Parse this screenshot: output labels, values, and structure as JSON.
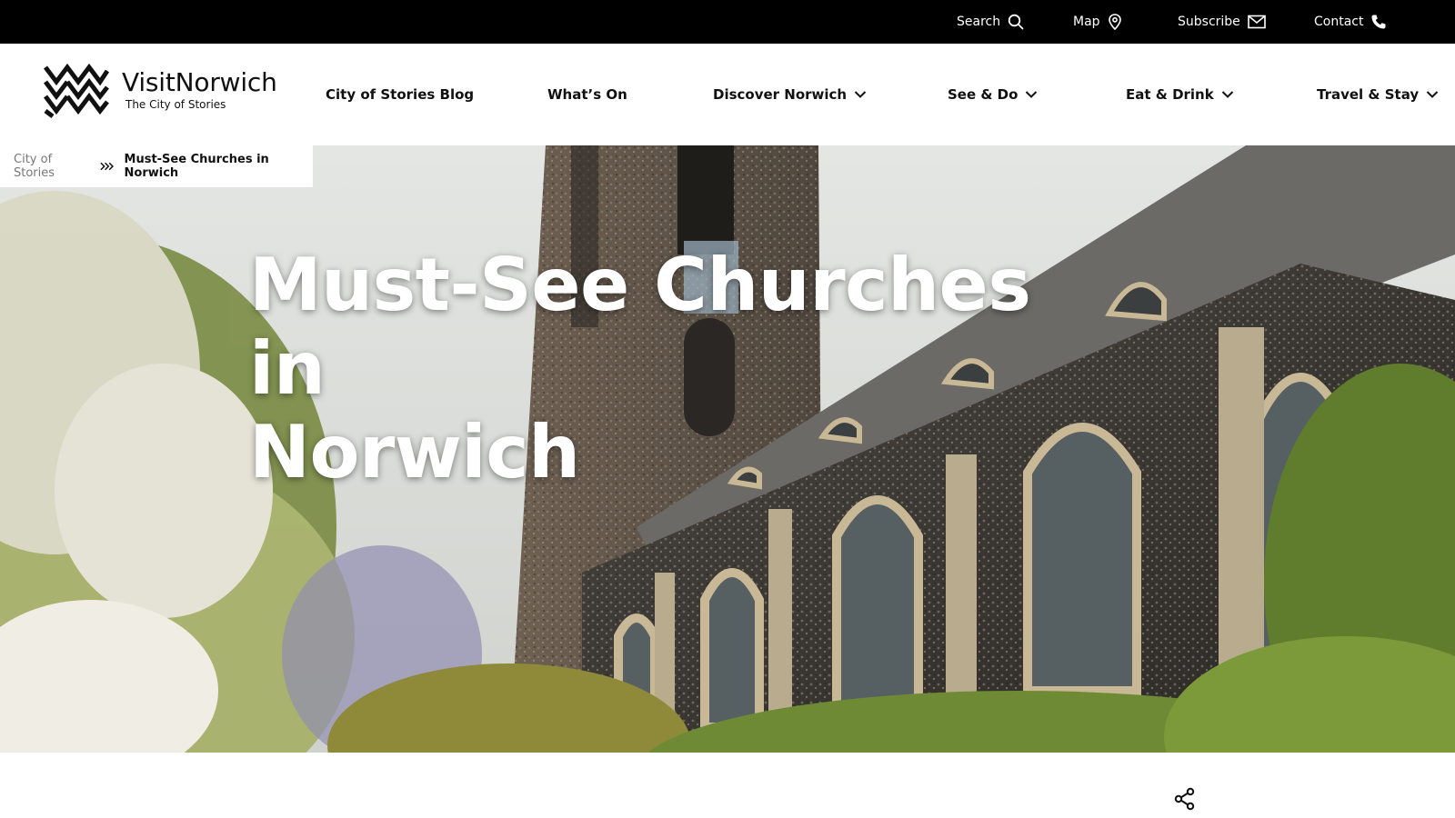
{
  "topbar": {
    "search_label": "Search",
    "map_label": "Map",
    "subscribe_label": "Subscribe",
    "contact_label": "Contact"
  },
  "logo": {
    "title": "VisitNorwich",
    "tagline": "The City of Stories"
  },
  "nav": {
    "items": [
      {
        "label": "City of Stories Blog",
        "has_dropdown": false
      },
      {
        "label": "What’s On",
        "has_dropdown": false
      },
      {
        "label": "Discover Norwich",
        "has_dropdown": true
      },
      {
        "label": "See & Do",
        "has_dropdown": true
      },
      {
        "label": "Eat & Drink",
        "has_dropdown": true
      },
      {
        "label": "Travel & Stay",
        "has_dropdown": true
      }
    ]
  },
  "breadcrumb": {
    "parent": "City of Stories",
    "current": "Must-See Churches in Norwich"
  },
  "hero": {
    "title_line1": "Must-See Churches in",
    "title_line2": "Norwich"
  },
  "colors": {
    "topbar_bg": "#000000",
    "nav_bg": "#ffffff",
    "text": "#111111",
    "breadcrumb_muted": "#777777"
  },
  "icons": {
    "search": "search-icon",
    "map": "map-pin-icon",
    "subscribe": "envelope-icon",
    "contact": "phone-icon",
    "dropdown": "chevron-down-icon",
    "breadcrumb_separator": "triple-chevron-right-icon",
    "share": "share-icon"
  }
}
